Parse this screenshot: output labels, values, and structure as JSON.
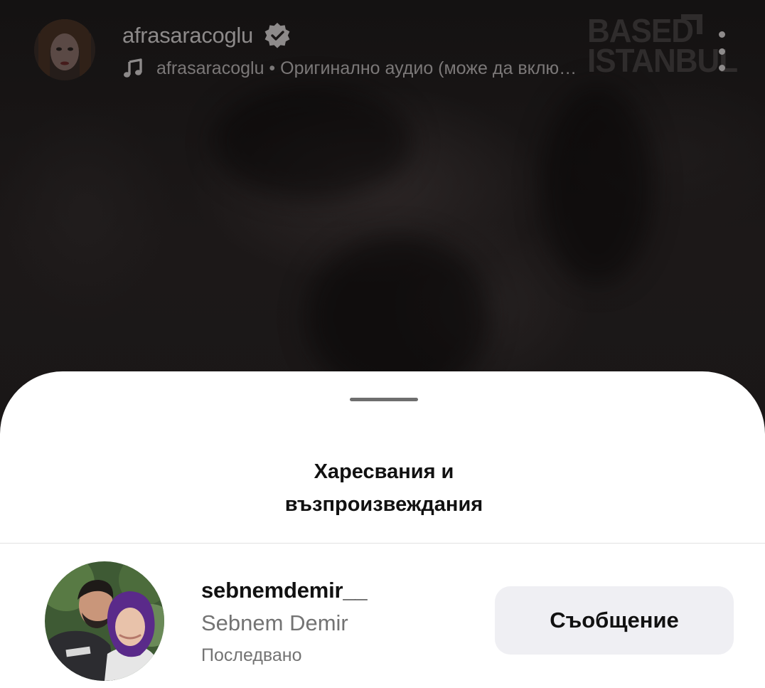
{
  "reel_header": {
    "username": "afrasaracoglu",
    "verified_icon": "verified-badge-icon",
    "audio_icon": "music-note-icon",
    "audio_text": "afrasaracoglu • Оригинално аудио (може да вклю…",
    "more_icon": "more-vertical-icon"
  },
  "watermark": {
    "line1": "BASED",
    "line2": "ISTANBUL"
  },
  "sheet": {
    "title": "Харесвания и възпроизвеждания"
  },
  "likes_list": [
    {
      "username": "sebnemdemir__",
      "full_name": "Sebnem Demir",
      "status": "Последвано",
      "action_label": "Съобщение"
    }
  ],
  "colors": {
    "sheet_background": "#ffffff",
    "button_background": "#efeff3",
    "secondary_text": "#737373",
    "video_background": "#161313",
    "hijab_color": "#5a2a8a"
  }
}
